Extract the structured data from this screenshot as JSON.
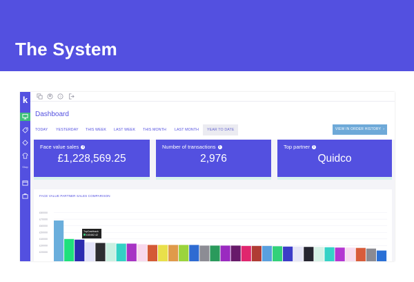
{
  "banner": {
    "title": "The System",
    "background": "#5350e0"
  },
  "sidebar": {
    "logo": "k",
    "label": "Shop",
    "items": [
      {
        "icon": "monitor-icon",
        "active": true
      },
      {
        "icon": "tag-icon",
        "active": false
      },
      {
        "icon": "tags-icon",
        "active": false
      },
      {
        "icon": "shirt-icon",
        "active": false
      },
      {
        "icon": "calendar-icon",
        "active": false
      },
      {
        "icon": "briefcase-icon",
        "active": false
      }
    ]
  },
  "topbar": {
    "icons": [
      "copy-icon",
      "user-icon",
      "help-icon",
      "logout-icon"
    ]
  },
  "header": {
    "title": "Dashboard",
    "tabs": [
      {
        "label": "TODAY",
        "active": false
      },
      {
        "label": "YESTERDAY",
        "active": false
      },
      {
        "label": "THIS WEEK",
        "active": false
      },
      {
        "label": "LAST WEEK",
        "active": false
      },
      {
        "label": "THIS MONTH",
        "active": false
      },
      {
        "label": "LAST MONTH",
        "active": false
      },
      {
        "label": "YEAR TO DATE",
        "active": true
      }
    ],
    "order_button": "VIEW IN ORDER HISTORY",
    "order_button_icon": "chevron-right-icon"
  },
  "cards": [
    {
      "label": "Face value sales",
      "value": "£1,228,569.25"
    },
    {
      "label": "Number of transactions",
      "value": "2,976"
    },
    {
      "label": "Top partner",
      "value": "Quidco"
    }
  ],
  "colors": {
    "accent": "#5350e0",
    "active_sidebar": "#3fc07a",
    "button": "#6ea9d8"
  },
  "chart_data": {
    "type": "bar",
    "title": "FACE VALUE PARTNER SALES COMPARISON",
    "y_ticks": [
      "£80000",
      "£70000",
      "£60000",
      "£50000",
      "£40000",
      "£30000",
      "£20000"
    ],
    "ylim": [
      0,
      90000
    ],
    "tooltip": {
      "name": "TopCashback",
      "value": "£40462.42"
    },
    "values": [
      68000,
      40000,
      39000,
      35000,
      34000,
      34000,
      33000,
      33000,
      32000,
      31000,
      31000,
      31000,
      31000,
      31000,
      30000,
      30000,
      30000,
      30000,
      29500,
      29500,
      29500,
      29000,
      28500,
      28500,
      28000,
      28000,
      27500,
      27000,
      27000,
      26500,
      25500,
      22500
    ],
    "colors": [
      "#6aaedc",
      "#1fe07c",
      "#2c2bb0",
      "#e3e3f9",
      "#2d2d31",
      "#c9f0e2",
      "#33d1c4",
      "#a734c4",
      "#f8d8ec",
      "#d45a36",
      "#e9e04a",
      "#e09a4a",
      "#9bd43c",
      "#2e6bd2",
      "#8c8c94",
      "#2a9a5c",
      "#9a2ac0",
      "#681a6a",
      "#e0266e",
      "#b03c34",
      "#5aa0de",
      "#32d17a",
      "#3c3cc8",
      "#e6e6f6",
      "#262630",
      "#d6f1e6",
      "#35d2c6",
      "#b436d2",
      "#f8dcef",
      "#d85c3a",
      "#8a8a92",
      "#2a70d6"
    ]
  }
}
